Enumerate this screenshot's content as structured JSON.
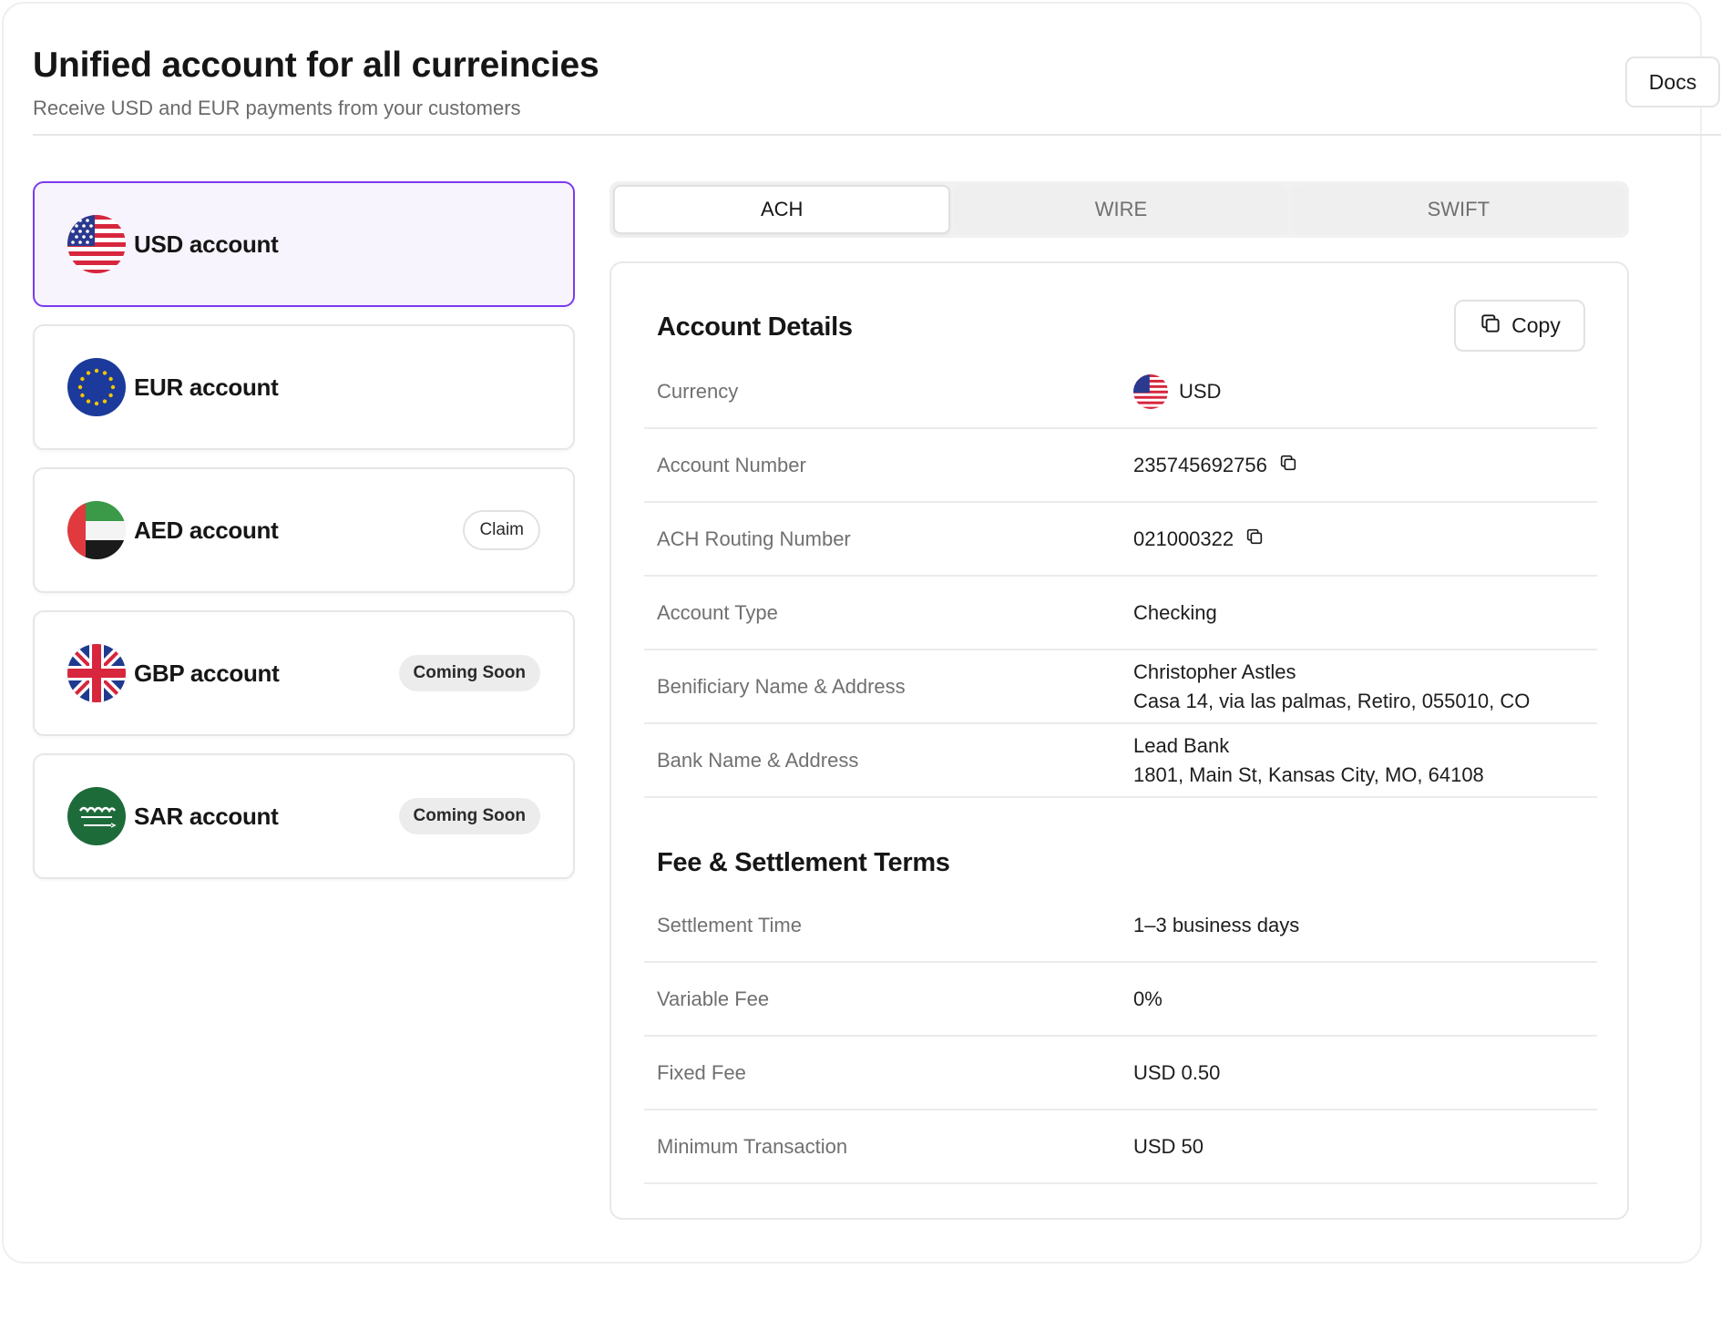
{
  "header": {
    "title": "Unified account for all curreincies",
    "subtitle": "Receive USD and EUR payments from your customers",
    "docs_label": "Docs"
  },
  "accounts": [
    {
      "label": "USD account",
      "flag": "us-flag-icon",
      "badge": "",
      "active": true
    },
    {
      "label": "EUR account",
      "flag": "eu-flag-icon",
      "badge": ""
    },
    {
      "label": "AED account",
      "flag": "ae-flag-icon",
      "badge": "Claim"
    },
    {
      "label": "GBP account",
      "flag": "gb-flag-icon",
      "badge": "Coming Soon"
    },
    {
      "label": "SAR account",
      "flag": "sa-flag-icon",
      "badge": "Coming Soon"
    }
  ],
  "tabs": [
    {
      "label": "ACH",
      "active": true
    },
    {
      "label": "WIRE"
    },
    {
      "label": "SWIFT"
    }
  ],
  "account_details": {
    "title": "Account Details",
    "copy_label": "Copy",
    "rows": [
      {
        "label": "Currency",
        "value": "USD"
      },
      {
        "label": "Account Number",
        "value": "235745692756"
      },
      {
        "label": "ACH Routing Number",
        "value": "021000322"
      },
      {
        "label": "Account Type",
        "value": "Checking"
      },
      {
        "label": "Benificiary Name & Address",
        "value_line1": "Christopher Astles",
        "value_line2": "Casa 14, via las palmas, Retiro, 055010, CO"
      },
      {
        "label": "Bank Name & Address",
        "value_line1": "Lead Bank",
        "value_line2": "1801, Main St, Kansas City, MO, 64108"
      }
    ]
  },
  "fees": {
    "title": "Fee & Settlement Terms",
    "rows": [
      {
        "label": "Settlement Time",
        "value": "1–3 business days"
      },
      {
        "label": "Variable Fee",
        "value": "0%"
      },
      {
        "label": "Fixed Fee",
        "value": "USD 0.50"
      },
      {
        "label": "Minimum Transaction",
        "value": "USD 50"
      }
    ]
  },
  "colors": {
    "accent": "#7c3aed",
    "active_card_bg": "#f7f4fd",
    "badge_bg": "#ececec"
  }
}
